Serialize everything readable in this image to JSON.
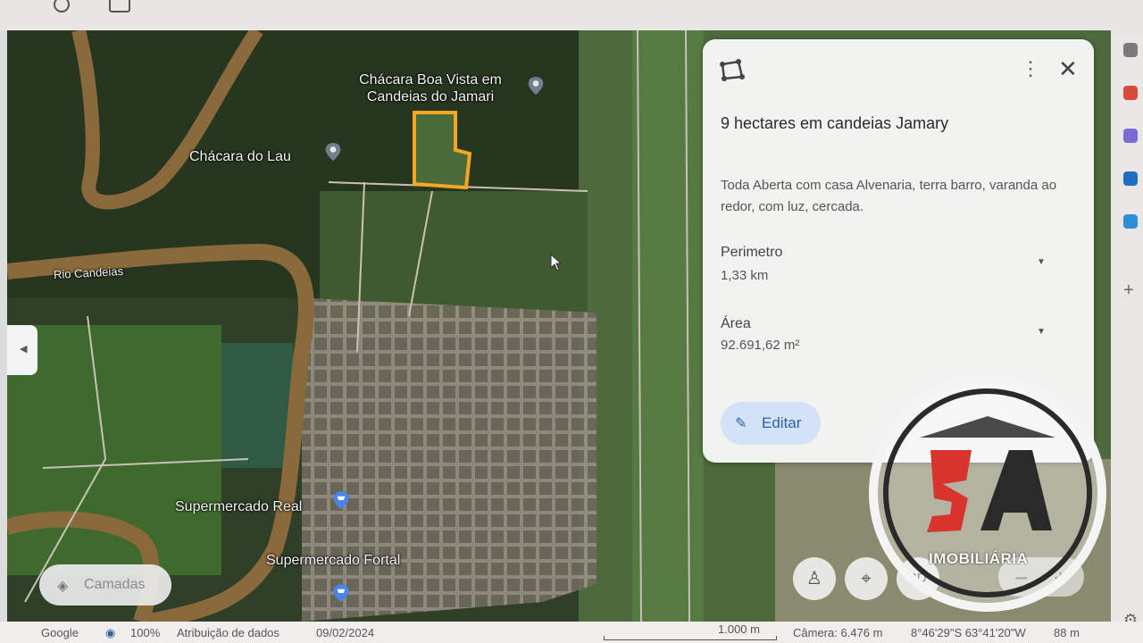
{
  "map": {
    "places": [
      {
        "name": "Chácara Boa Vista em Candeias do Jamari"
      },
      {
        "name": "Chácara do Lau"
      },
      {
        "name": "Supermercado Real"
      },
      {
        "name": "Supermercado Fortal"
      }
    ],
    "river_label": "Rio Candeias",
    "polygon_color": "#f5a623",
    "layers_label": "Camadas"
  },
  "panel": {
    "title": "9 hectares em candeias Jamary",
    "description": "Toda Aberta com casa Alvenaria, terra barro, varanda ao redor, com luz, cercada.",
    "perimeter_label": "Perimetro",
    "perimeter_value": "1,33 km",
    "area_label": "Área",
    "area_value": "92.691,62 m²",
    "edit_label": "Editar"
  },
  "status_bar": {
    "brand": "Google",
    "zoom": "100%",
    "attribution": "Atribuição de dados",
    "date": "09/02/2024",
    "scale": "1.000 m",
    "camera": "Câmera: 6.476 m",
    "coordinates": "8°46'29\"S 63°41'20\"W",
    "elevation": "88 m"
  },
  "controls": {
    "view_3d": "3D"
  },
  "watermark": {
    "text": "IMOBILIÁRIA",
    "logo": "3A"
  },
  "icons": [
    "polygon-icon",
    "more-vert-icon",
    "close-icon",
    "pencil-icon",
    "layers-icon",
    "pegman-icon",
    "crosshair-icon",
    "zoom-out-icon",
    "zoom-in-icon",
    "pin-icon",
    "shop-pin-icon"
  ]
}
